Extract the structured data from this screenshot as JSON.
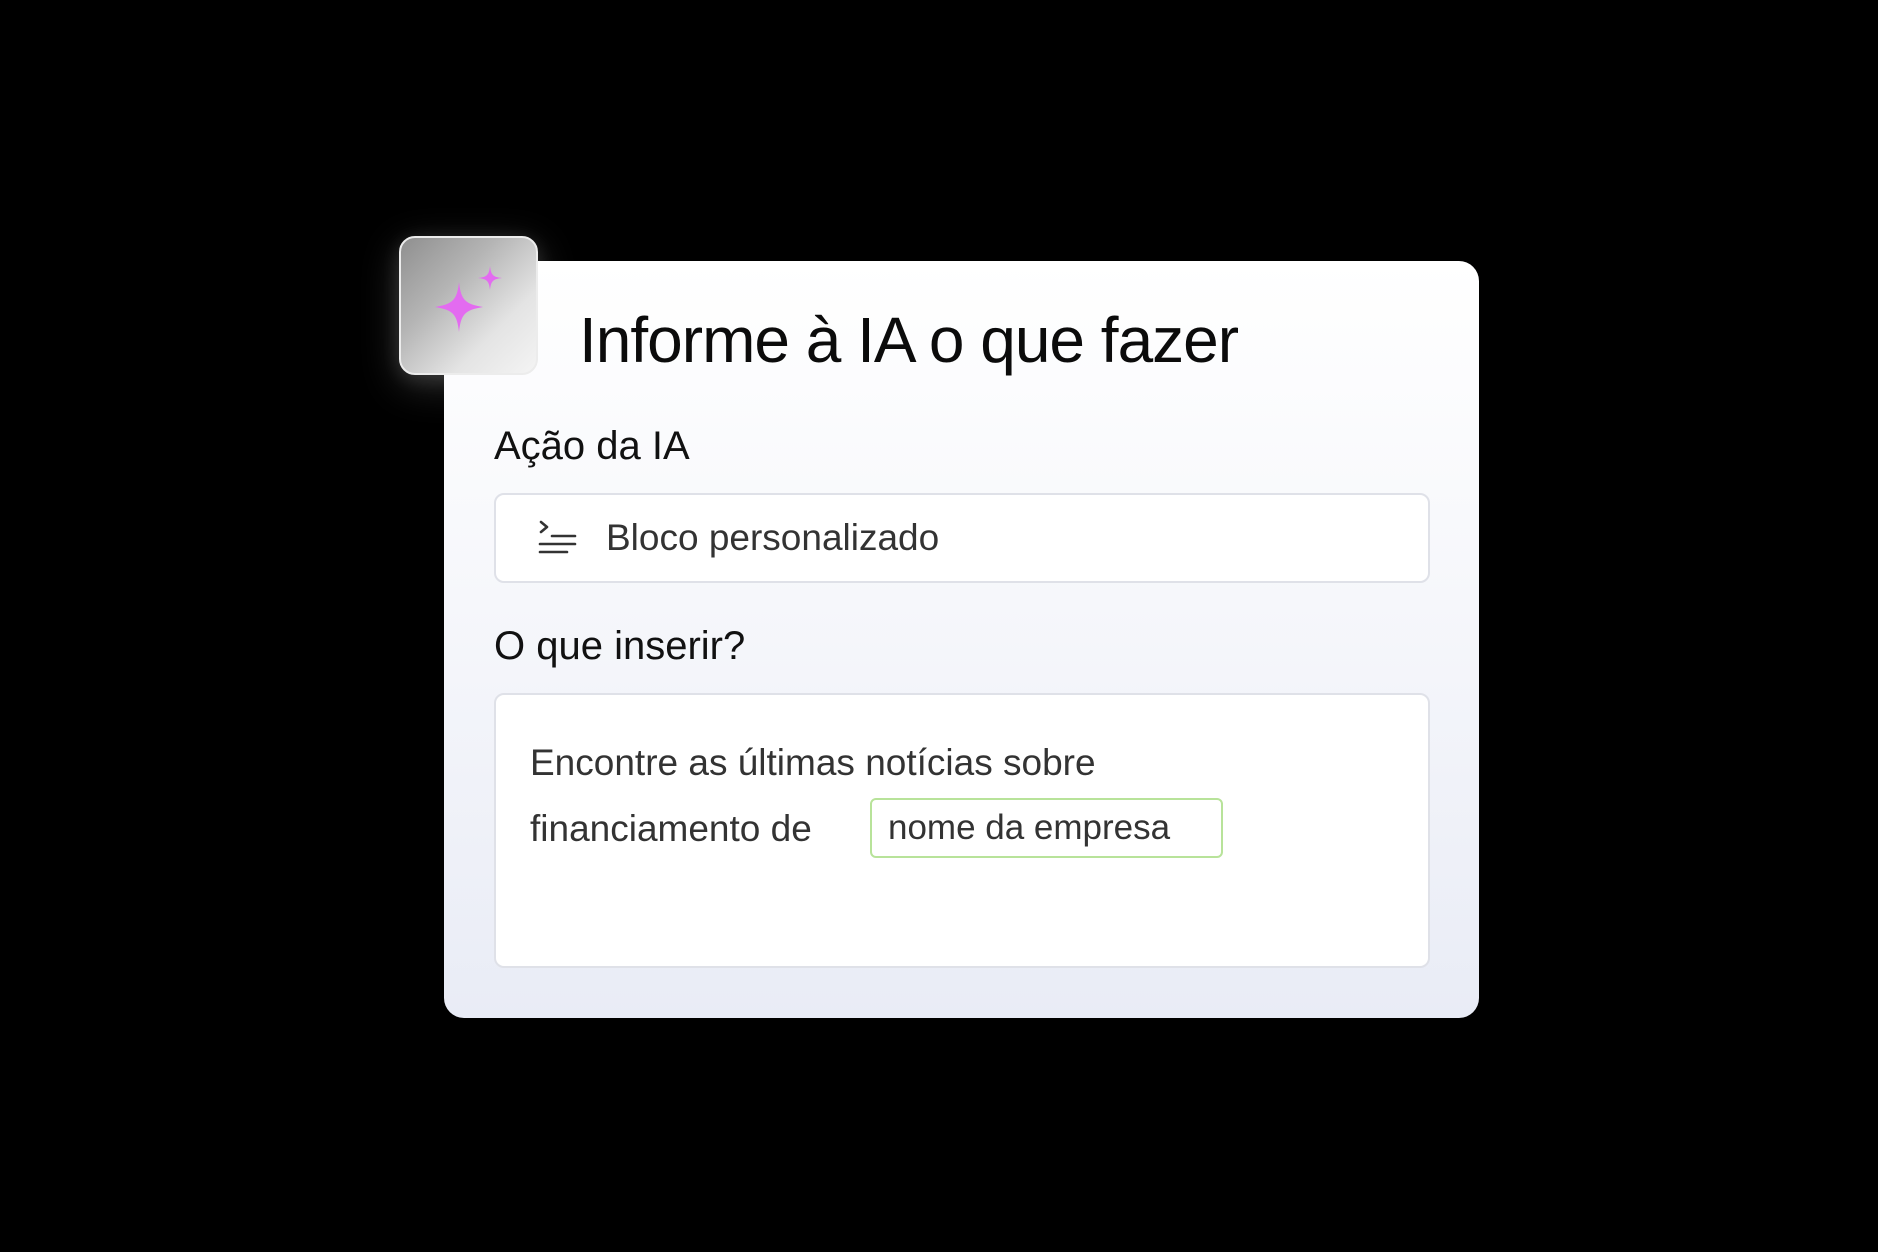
{
  "header": {
    "title": "Informe à IA o que fazer",
    "badge_icon": "sparkles-icon",
    "badge_icon_color": "#E36BF0"
  },
  "action": {
    "label": "Ação da IA",
    "selected_value": "Bloco personalizado",
    "icon": "prompt-list-icon"
  },
  "insert": {
    "label": "O que inserir?",
    "prompt_line_1": "Encontre as últimas notícias sobre",
    "prompt_line_2": "financiamento de",
    "variable_chip": "nome da empresa",
    "chip_border_color": "#B8E39A"
  }
}
